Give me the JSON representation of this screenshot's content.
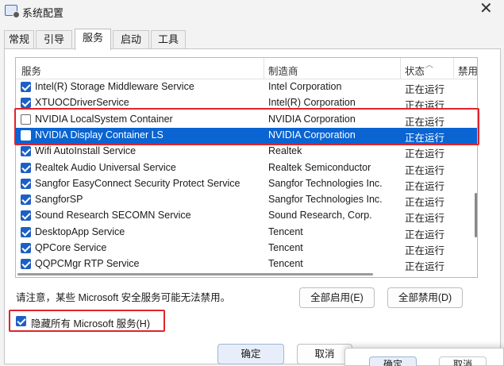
{
  "window": {
    "title": "系统配置",
    "close_glyph": "✕"
  },
  "tabs": [
    "常规",
    "引导",
    "服务",
    "启动",
    "工具"
  ],
  "active_tab": 2,
  "columns": {
    "service": "服务",
    "manufacturer": "制造商",
    "status": "状态",
    "disabled_date": "禁用"
  },
  "rows": [
    {
      "name": "Intel(R) Storage Middleware Service",
      "manufacturer": "Intel Corporation",
      "status": "正在运行",
      "checked": true
    },
    {
      "name": "XTUOCDriverService",
      "manufacturer": "Intel(R) Corporation",
      "status": "正在运行",
      "checked": true
    },
    {
      "name": "NVIDIA LocalSystem Container",
      "manufacturer": "NVIDIA Corporation",
      "status": "正在运行",
      "checked": false
    },
    {
      "name": "NVIDIA Display Container LS",
      "manufacturer": "NVIDIA Corporation",
      "status": "正在运行",
      "checked": false,
      "selected": true
    },
    {
      "name": "Wifi AutoInstall Service",
      "manufacturer": "Realtek",
      "status": "正在运行",
      "checked": true
    },
    {
      "name": "Realtek Audio Universal Service",
      "manufacturer": "Realtek Semiconductor",
      "status": "正在运行",
      "checked": true
    },
    {
      "name": "Sangfor EasyConnect Security Protect Service",
      "manufacturer": "Sangfor Technologies Inc.",
      "status": "正在运行",
      "checked": true
    },
    {
      "name": "SangforSP",
      "manufacturer": "Sangfor Technologies Inc.",
      "status": "正在运行",
      "checked": true
    },
    {
      "name": "Sound Research SECOMN Service",
      "manufacturer": "Sound Research, Corp.",
      "status": "正在运行",
      "checked": true
    },
    {
      "name": "DesktopApp Service",
      "manufacturer": "Tencent",
      "status": "正在运行",
      "checked": true
    },
    {
      "name": "QPCore Service",
      "manufacturer": "Tencent",
      "status": "正在运行",
      "checked": true
    },
    {
      "name": "QQPCMgr RTP Service",
      "manufacturer": "Tencent",
      "status": "正在运行",
      "checked": true
    }
  ],
  "note": "请注意，某些 Microsoft 安全服务可能无法禁用。",
  "buttons": {
    "enable_all": "全部启用(E)",
    "disable_all": "全部禁用(D)",
    "ok": "确定",
    "cancel": "取消"
  },
  "hide_ms": {
    "label": "隐藏所有 Microsoft 服务(H)",
    "checked": true
  },
  "overlay": {
    "ok": "确定",
    "cancel": "取消"
  },
  "colors": {
    "selection": "#0a64d1",
    "checkbox": "#1d5fc4",
    "highlight_box": "#e0242a"
  }
}
